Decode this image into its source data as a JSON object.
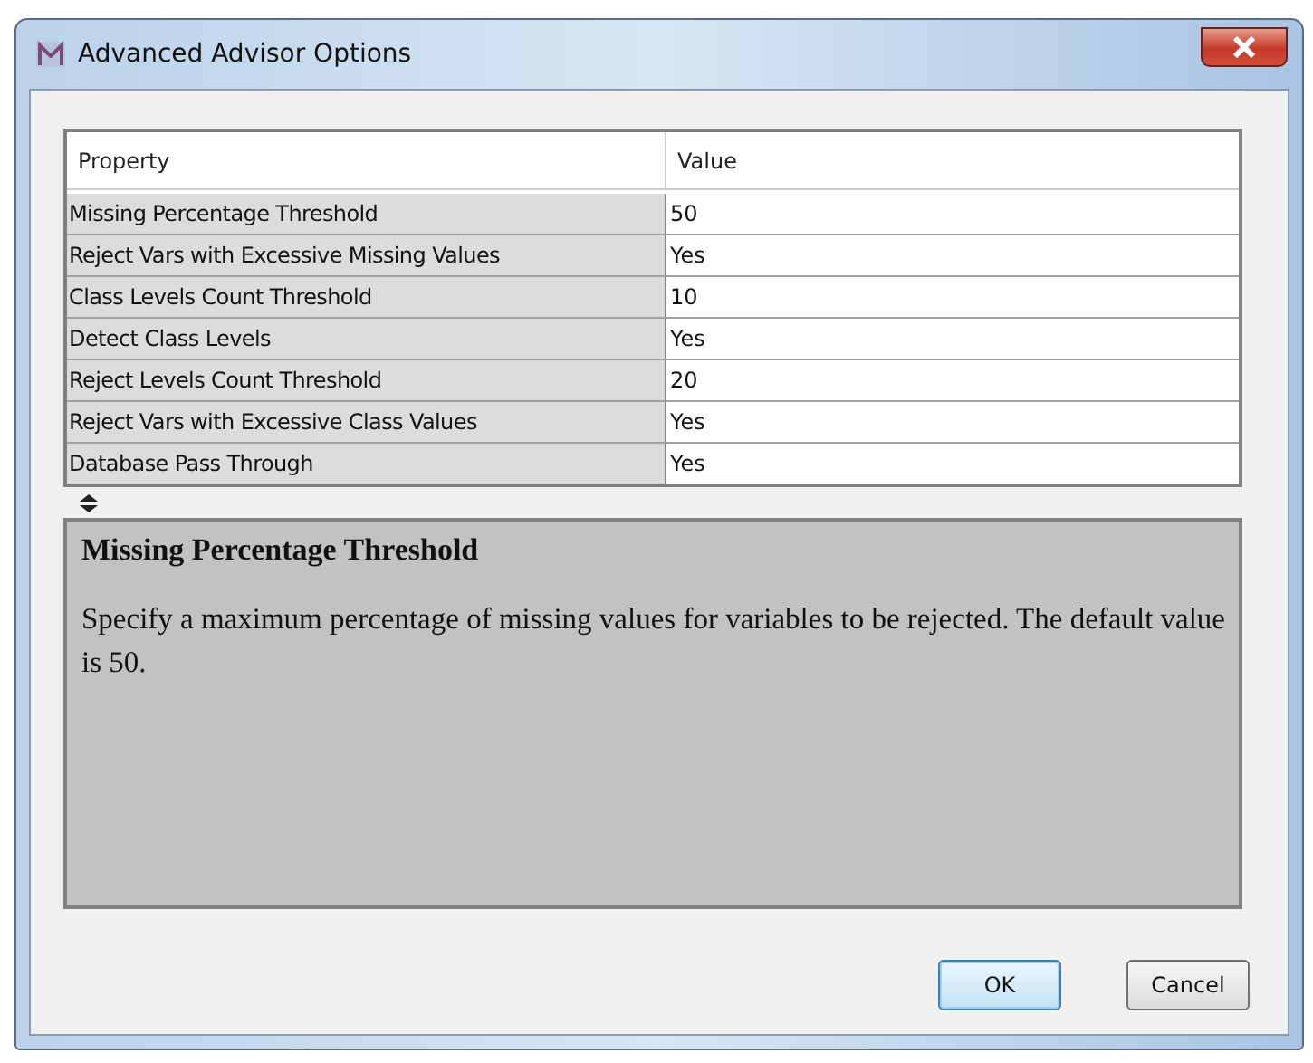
{
  "window": {
    "title": "Advanced Advisor Options"
  },
  "table": {
    "columns": [
      "Property",
      "Value"
    ],
    "rows": [
      {
        "property": "Missing Percentage Threshold",
        "value": "50"
      },
      {
        "property": "Reject Vars with Excessive Missing Values",
        "value": "Yes"
      },
      {
        "property": "Class Levels Count Threshold",
        "value": "10"
      },
      {
        "property": "Detect Class Levels",
        "value": "Yes"
      },
      {
        "property": "Reject Levels Count Threshold",
        "value": "20"
      },
      {
        "property": "Reject Vars with Excessive Class Values",
        "value": "Yes"
      },
      {
        "property": "Database Pass Through",
        "value": "Yes"
      }
    ]
  },
  "description": {
    "title": "Missing Percentage Threshold",
    "text": "Specify a maximum percentage of missing values for variables to be rejected. The default value is 50."
  },
  "buttons": [
    {
      "label": "OK",
      "default": true
    },
    {
      "label": "Cancel",
      "default": false
    }
  ]
}
